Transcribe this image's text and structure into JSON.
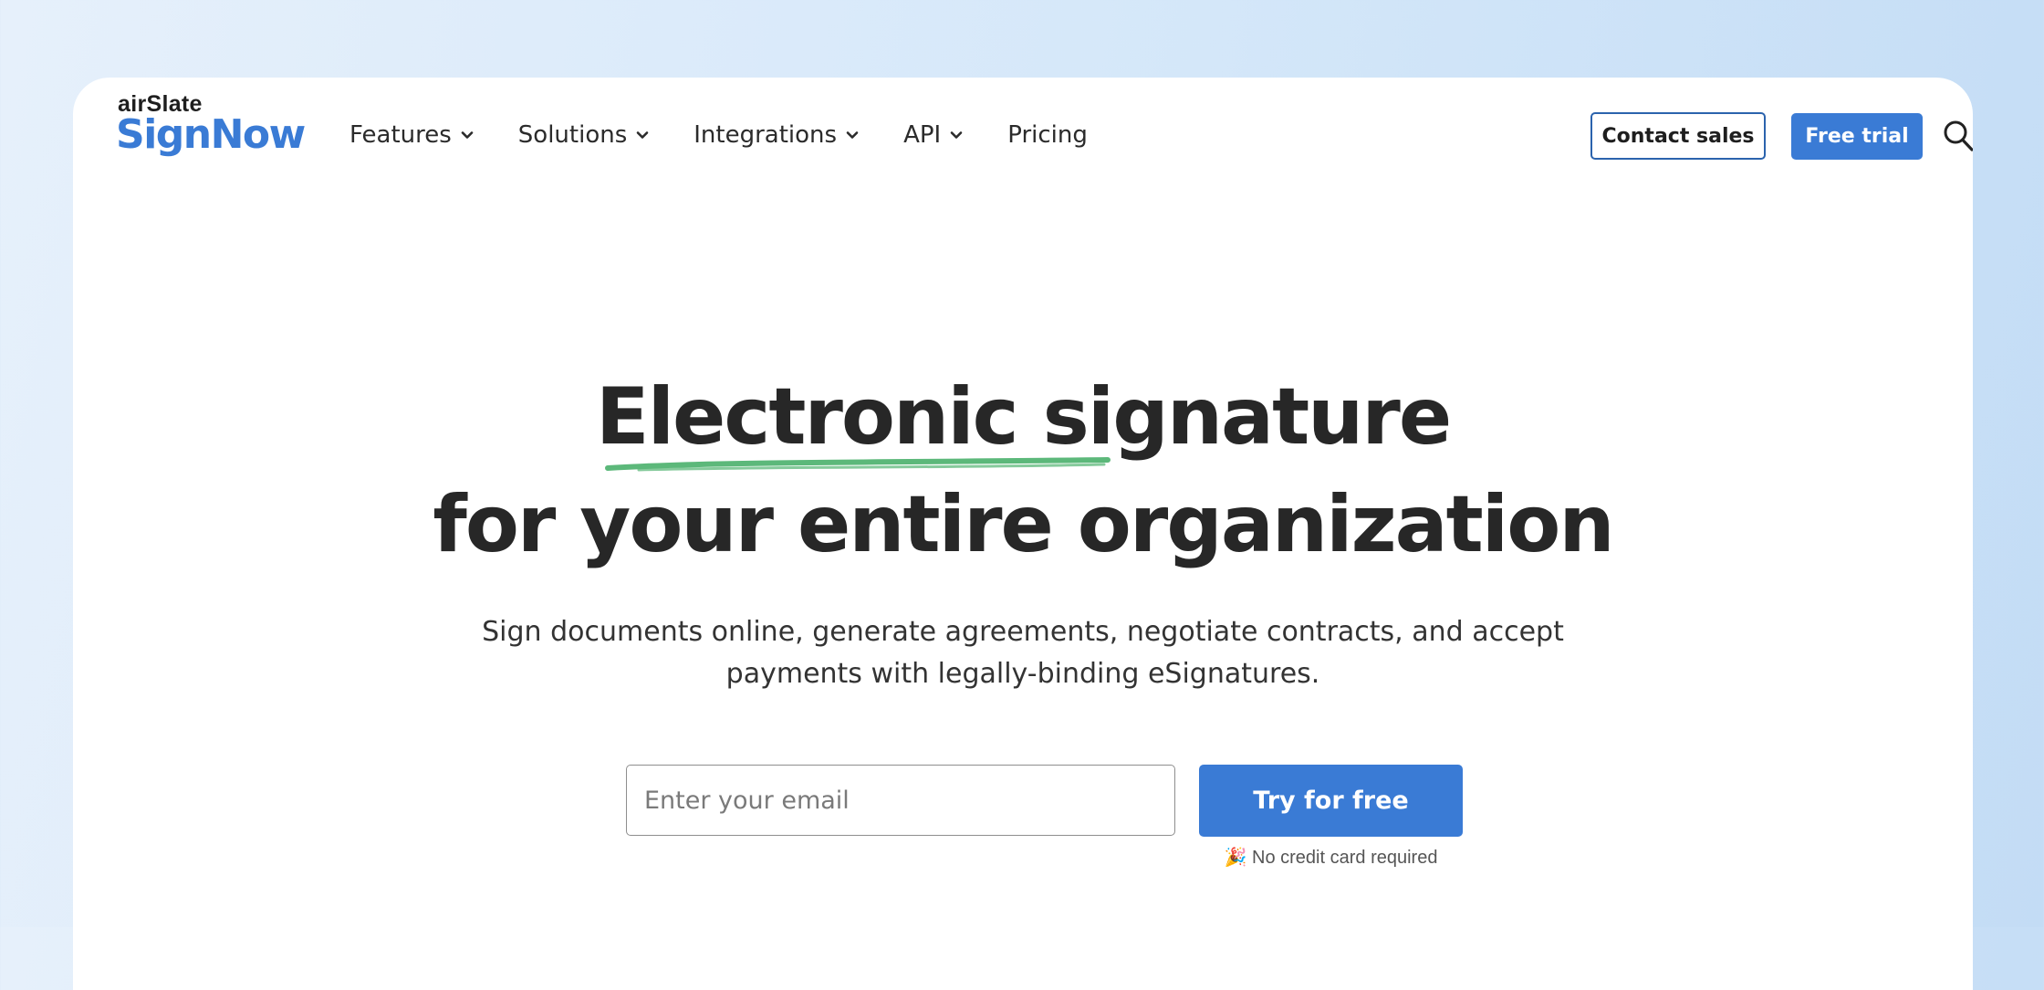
{
  "header": {
    "logo": {
      "brand_top": "airSlate",
      "brand_main": "SignNow"
    },
    "nav": [
      {
        "label": "Features",
        "has_dropdown": true
      },
      {
        "label": "Solutions",
        "has_dropdown": true
      },
      {
        "label": "Integrations",
        "has_dropdown": true
      },
      {
        "label": "API",
        "has_dropdown": true
      },
      {
        "label": "Pricing",
        "has_dropdown": false
      }
    ],
    "contact_sales_label": "Contact sales",
    "free_trial_label": "Free trial",
    "search_icon": "search-icon"
  },
  "hero": {
    "title_line1": "Electronic signature",
    "title_line2": "for your entire organization",
    "subtitle_line1": "Sign documents online, generate agreements, negotiate contracts, and accept",
    "subtitle_line2": "payments with legally-binding eSignatures.",
    "email_placeholder": "Enter your email",
    "email_value": "",
    "cta_label": "Try for free",
    "note_emoji": "🎉",
    "note_text": "No credit card required"
  },
  "colors": {
    "brand_blue": "#3a7bd5",
    "heading": "#272727",
    "underline_green": "#5cb87a",
    "background_light": "#e6f0fb"
  }
}
